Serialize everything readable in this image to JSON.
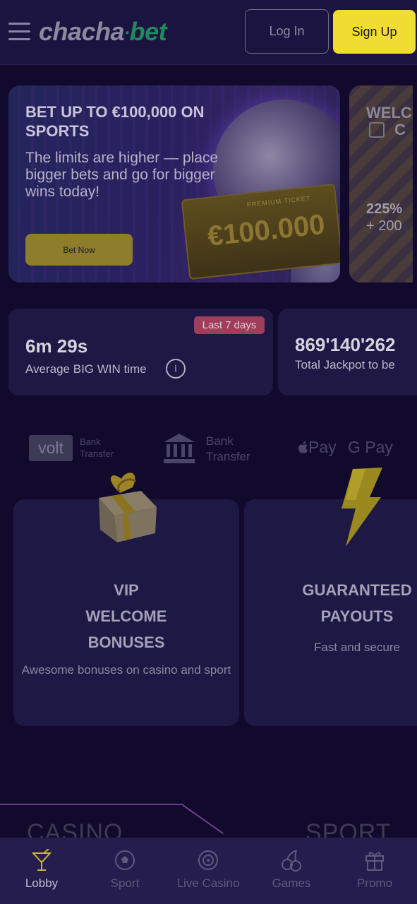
{
  "header": {
    "logo_prefix": "chacha",
    "logo_sep": "·",
    "logo_suffix": "bet",
    "login_label": "Log In",
    "signup_label": "Sign Up"
  },
  "banner": {
    "title": "BET UP TO €100,000 ON SPORTS",
    "text": "The limits are higher — place bigger bets and go for bigger wins today!",
    "button_label": "Bet Now",
    "ticket_small": "PREMIUM TICKET",
    "ticket_amount": "€100.000"
  },
  "banner2": {
    "title": "WELC",
    "title2": "C",
    "line1": "225%",
    "line2": "+ 200"
  },
  "stats": [
    {
      "badge": "Last 7 days",
      "value": "6m 29s",
      "label": "Average BIG WIN time",
      "info": "i"
    },
    {
      "value": "869'140'262",
      "label": "Total Jackpot to be"
    }
  ],
  "payments": {
    "volt": "volt",
    "volt_sub_1": "Bank",
    "volt_sub_2": "Transfer",
    "bank_1": "Bank",
    "bank_2": "Transfer",
    "apple": "Pay",
    "gpay": "G Pay"
  },
  "cards": [
    {
      "title_1": "VIP",
      "title_2": "WELCOME",
      "title_3": "BONUSES",
      "text": "Awesome bonuses on casino and sport"
    },
    {
      "title_1": "GUARANTEED",
      "title_2": "PAYOUTS",
      "text": "Fast and secure"
    }
  ],
  "sections": {
    "casino": "CASINO",
    "sport": "SPORT"
  },
  "nav": [
    {
      "label": "Lobby",
      "active": true
    },
    {
      "label": "Sport",
      "active": false
    },
    {
      "label": "Live Casino",
      "active": false
    },
    {
      "label": "Games",
      "active": false
    },
    {
      "label": "Promo",
      "active": false
    }
  ],
  "colors": {
    "accent": "#f1dc32",
    "background": "#110a2c",
    "brand_green": "#1e8a5e"
  }
}
